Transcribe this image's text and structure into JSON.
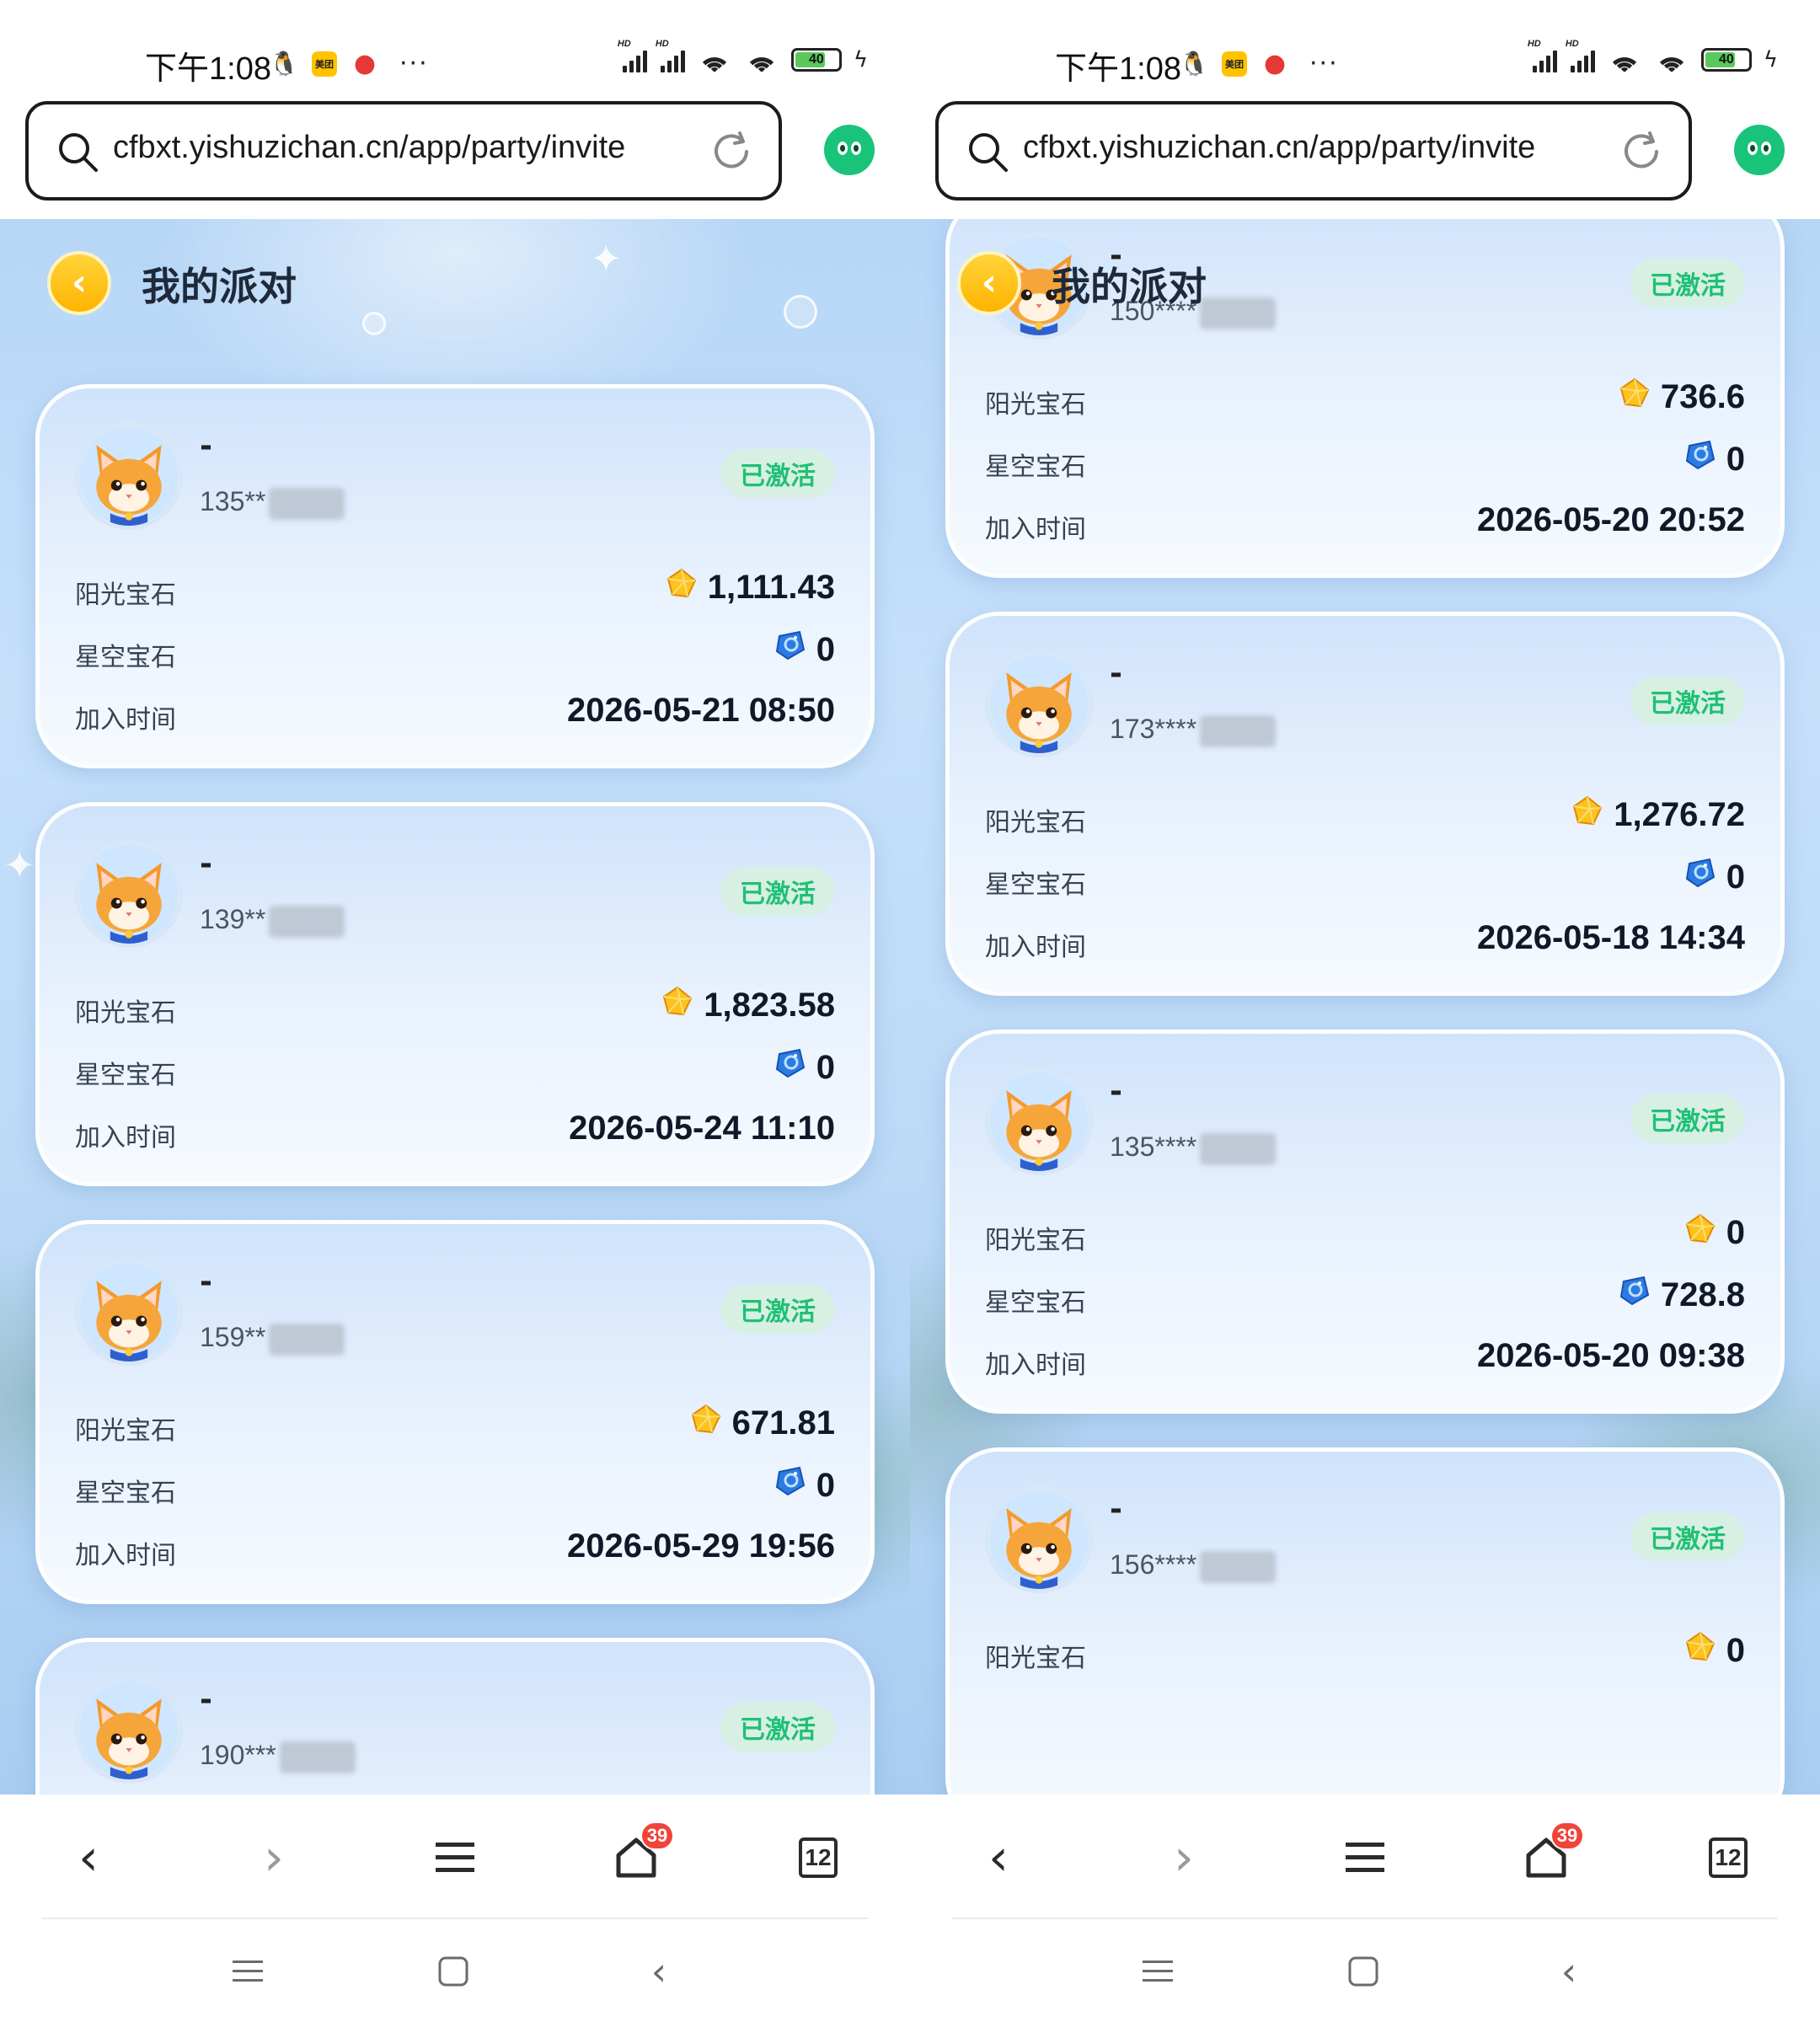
{
  "status_bar": {
    "time": "下午1:08",
    "battery": "40",
    "dots": "···",
    "hd": "HD"
  },
  "browser": {
    "url": "cfbxt.yishuzichan.cn/app/party/invite",
    "tab_count": "12",
    "notification_count": "39",
    "icons": [
      "back-icon",
      "forward-icon",
      "menu-icon",
      "home-icon",
      "tabs-icon"
    ]
  },
  "page": {
    "title": "我的派对",
    "labels": {
      "sun_gem": "阳光宝石",
      "star_gem": "星空宝石",
      "join_time": "加入时间"
    },
    "status_active": "已激活",
    "colors": {
      "badge_text": "#1fc174",
      "badge_bg": "#d8f0e4",
      "back_button": "#ffc107"
    }
  },
  "screens": [
    {
      "members": [
        {
          "nickname": "-",
          "phone": "135**",
          "sun": "1,111.43",
          "star": "0",
          "joined": "2026-05-21 08:50"
        },
        {
          "nickname": "-",
          "phone": "139**",
          "sun": "1,823.58",
          "star": "0",
          "joined": "2026-05-24 11:10"
        },
        {
          "nickname": "-",
          "phone": "159**",
          "sun": "671.81",
          "star": "0",
          "joined": "2026-05-29 19:56"
        },
        {
          "nickname": "-",
          "phone": "190***",
          "sun": "",
          "star": "",
          "joined": ""
        }
      ]
    },
    {
      "members": [
        {
          "nickname": "-",
          "phone": "150****",
          "sun": "736.6",
          "star": "0",
          "joined": "2026-05-20 20:52"
        },
        {
          "nickname": "-",
          "phone": "173****",
          "sun": "1,276.72",
          "star": "0",
          "joined": "2026-05-18 14:34"
        },
        {
          "nickname": "-",
          "phone": "135****",
          "sun": "0",
          "star": "728.8",
          "joined": "2026-05-20 09:38"
        },
        {
          "nickname": "-",
          "phone": "156****",
          "sun": "0",
          "star": "",
          "joined": ""
        }
      ]
    }
  ]
}
